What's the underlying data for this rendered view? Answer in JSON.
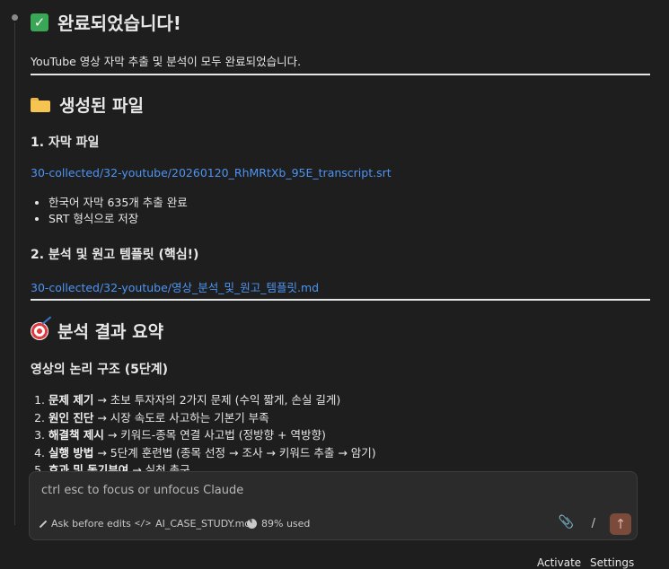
{
  "heading_done": "완료되었습니다!",
  "intro_text": "YouTube 영상 자막 추출 및 분석이 모두 완료되었습니다.",
  "files_section": {
    "heading": "생성된 파일",
    "items": [
      {
        "heading": "1. 자막 파일",
        "link": "30-collected/32-youtube/20260120_RhMRtXb_95E_transcript.srt",
        "bullets": [
          "한국어 자막 635개 추출 완료",
          "SRT 형식으로 저장"
        ]
      },
      {
        "heading": "2. 분석 및 원고 템플릿 (핵심!)",
        "link": "30-collected/32-youtube/영상_분석_및_원고_템플릿.md"
      }
    ]
  },
  "summary_section": {
    "heading": "분석 결과 요약",
    "subheading": "영상의 논리 구조 (5단계)",
    "steps": [
      {
        "title": "문제 제기",
        "desc": " → 초보 투자자의 2가지 문제 (수익 짧게, 손실 길게)"
      },
      {
        "title": "원인 진단",
        "desc": " → 시장 속도로 사고하는 기본기 부족"
      },
      {
        "title": "해결책 제시",
        "desc": " → 키워드-종목 연결 사고법 (정방향 + 역방향)"
      },
      {
        "title": "실행 방법",
        "desc": " → 5단계 훈련법 (종목 선정 → 조사 → 키워드 추출 → 암기)"
      },
      {
        "title": "효과 및 동기부여",
        "desc": " → 실천 촉구"
      }
    ]
  },
  "chat": {
    "placeholder": "ctrl esc to focus or unfocus Claude",
    "mode_label": "Ask before edits",
    "file_label": "AI_CASE_STUDY.md",
    "usage_label": "89% used",
    "slash_label": "/"
  },
  "status_bar": {
    "text": "Activate",
    "settings": "Settings"
  },
  "colors": {
    "background": "#1e1e1e",
    "link": "#4e94f2",
    "send_button": "#7a4a3a"
  },
  "icons": [
    "check-icon",
    "folder-icon",
    "target-icon",
    "pencil-icon",
    "code-icon",
    "pie-icon",
    "paperclip-icon",
    "arrow-up-icon"
  ]
}
